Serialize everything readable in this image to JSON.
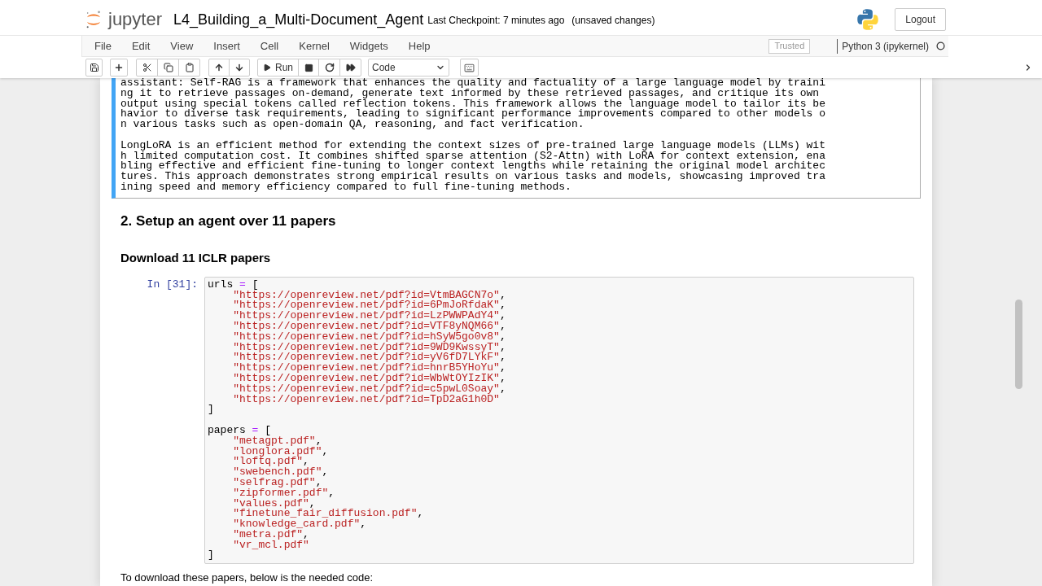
{
  "header": {
    "logo_text": "jupyter",
    "notebook_name": "L4_Building_a_Multi-Document_Agent",
    "checkpoint": "Last Checkpoint: 7 minutes ago",
    "save_status": "(unsaved changes)",
    "logout": "Logout"
  },
  "menu": {
    "items": [
      "File",
      "Edit",
      "View",
      "Insert",
      "Cell",
      "Kernel",
      "Widgets",
      "Help"
    ],
    "trusted": "Trusted",
    "kernel": {
      "name": "Python 3 (ipykernel)",
      "busy": false
    }
  },
  "toolbar": {
    "run_label": "Run",
    "cell_type": "Code"
  },
  "cells": [
    {
      "kind": "output",
      "selected": true,
      "paragraphs": [
        "assistant: Self-RAG is a framework that enhances the quality and factuality of a large language model by training it to retrieve passages on-demand, generate text informed by these retrieved passages, and critique its own output using special tokens called reflection tokens. This framework allows the language model to tailor its behavior to diverse task requirements, leading to significant performance improvements compared to other models on various tasks such as open-domain QA, reasoning, and fact verification.",
        "LongLoRA is an efficient method for extending the context sizes of pre-trained large language models (LLMs) with limited computation cost. It combines shifted sparse attention (S2-Attn) with LoRA for context extension, enabling effective and efficient fine-tuning to longer context lengths while retaining the original model architectures. This approach demonstrates strong empirical results on various tasks and models, showcasing improved training speed and memory efficiency compared to full fine-tuning methods."
      ]
    },
    {
      "kind": "heading",
      "selected": false,
      "text": "2. Setup an agent over 11 papers"
    },
    {
      "kind": "subheading",
      "selected": false,
      "text": "Download 11 ICLR papers"
    },
    {
      "kind": "code",
      "selected": false,
      "prompt": "In [31]:",
      "blocks": [
        [
          "urls = [",
          "    \"https://openreview.net/pdf?id=VtmBAGCN7o\",",
          "    \"https://openreview.net/pdf?id=6PmJoRfdaK\",",
          "    \"https://openreview.net/pdf?id=LzPWWPAdY4\",",
          "    \"https://openreview.net/pdf?id=VTF8yNQM66\",",
          "    \"https://openreview.net/pdf?id=hSyW5go0v8\",",
          "    \"https://openreview.net/pdf?id=9WD9KwssyT\",",
          "    \"https://openreview.net/pdf?id=yV6fD7LYkF\",",
          "    \"https://openreview.net/pdf?id=hnrB5YHoYu\",",
          "    \"https://openreview.net/pdf?id=WbWtOYIzIK\",",
          "    \"https://openreview.net/pdf?id=c5pwL0Soay\",",
          "    \"https://openreview.net/pdf?id=TpD2aG1h0D\"",
          "]"
        ],
        [
          "papers = [",
          "    \"metagpt.pdf\",",
          "    \"longlora.pdf\",",
          "    \"loftq.pdf\",",
          "    \"swebench.pdf\",",
          "    \"selfrag.pdf\",",
          "    \"zipformer.pdf\",",
          "    \"values.pdf\",",
          "    \"finetune_fair_diffusion.pdf\",",
          "    \"knowledge_card.pdf\",",
          "    \"metra.pdf\",",
          "    \"vr_mcl.pdf\"",
          "]"
        ]
      ]
    },
    {
      "kind": "text",
      "selected": false,
      "text": "To download these papers, below is the needed code:"
    }
  ]
}
